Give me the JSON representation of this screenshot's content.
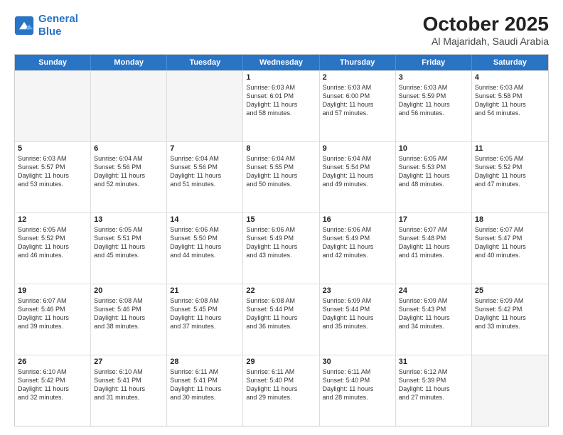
{
  "logo": {
    "line1": "General",
    "line2": "Blue"
  },
  "title": "October 2025",
  "subtitle": "Al Majaridah, Saudi Arabia",
  "days": [
    "Sunday",
    "Monday",
    "Tuesday",
    "Wednesday",
    "Thursday",
    "Friday",
    "Saturday"
  ],
  "weeks": [
    [
      {
        "day": "",
        "info": ""
      },
      {
        "day": "",
        "info": ""
      },
      {
        "day": "",
        "info": ""
      },
      {
        "day": "1",
        "info": "Sunrise: 6:03 AM\nSunset: 6:01 PM\nDaylight: 11 hours\nand 58 minutes."
      },
      {
        "day": "2",
        "info": "Sunrise: 6:03 AM\nSunset: 6:00 PM\nDaylight: 11 hours\nand 57 minutes."
      },
      {
        "day": "3",
        "info": "Sunrise: 6:03 AM\nSunset: 5:59 PM\nDaylight: 11 hours\nand 56 minutes."
      },
      {
        "day": "4",
        "info": "Sunrise: 6:03 AM\nSunset: 5:58 PM\nDaylight: 11 hours\nand 54 minutes."
      }
    ],
    [
      {
        "day": "5",
        "info": "Sunrise: 6:03 AM\nSunset: 5:57 PM\nDaylight: 11 hours\nand 53 minutes."
      },
      {
        "day": "6",
        "info": "Sunrise: 6:04 AM\nSunset: 5:56 PM\nDaylight: 11 hours\nand 52 minutes."
      },
      {
        "day": "7",
        "info": "Sunrise: 6:04 AM\nSunset: 5:56 PM\nDaylight: 11 hours\nand 51 minutes."
      },
      {
        "day": "8",
        "info": "Sunrise: 6:04 AM\nSunset: 5:55 PM\nDaylight: 11 hours\nand 50 minutes."
      },
      {
        "day": "9",
        "info": "Sunrise: 6:04 AM\nSunset: 5:54 PM\nDaylight: 11 hours\nand 49 minutes."
      },
      {
        "day": "10",
        "info": "Sunrise: 6:05 AM\nSunset: 5:53 PM\nDaylight: 11 hours\nand 48 minutes."
      },
      {
        "day": "11",
        "info": "Sunrise: 6:05 AM\nSunset: 5:52 PM\nDaylight: 11 hours\nand 47 minutes."
      }
    ],
    [
      {
        "day": "12",
        "info": "Sunrise: 6:05 AM\nSunset: 5:52 PM\nDaylight: 11 hours\nand 46 minutes."
      },
      {
        "day": "13",
        "info": "Sunrise: 6:05 AM\nSunset: 5:51 PM\nDaylight: 11 hours\nand 45 minutes."
      },
      {
        "day": "14",
        "info": "Sunrise: 6:06 AM\nSunset: 5:50 PM\nDaylight: 11 hours\nand 44 minutes."
      },
      {
        "day": "15",
        "info": "Sunrise: 6:06 AM\nSunset: 5:49 PM\nDaylight: 11 hours\nand 43 minutes."
      },
      {
        "day": "16",
        "info": "Sunrise: 6:06 AM\nSunset: 5:49 PM\nDaylight: 11 hours\nand 42 minutes."
      },
      {
        "day": "17",
        "info": "Sunrise: 6:07 AM\nSunset: 5:48 PM\nDaylight: 11 hours\nand 41 minutes."
      },
      {
        "day": "18",
        "info": "Sunrise: 6:07 AM\nSunset: 5:47 PM\nDaylight: 11 hours\nand 40 minutes."
      }
    ],
    [
      {
        "day": "19",
        "info": "Sunrise: 6:07 AM\nSunset: 5:46 PM\nDaylight: 11 hours\nand 39 minutes."
      },
      {
        "day": "20",
        "info": "Sunrise: 6:08 AM\nSunset: 5:46 PM\nDaylight: 11 hours\nand 38 minutes."
      },
      {
        "day": "21",
        "info": "Sunrise: 6:08 AM\nSunset: 5:45 PM\nDaylight: 11 hours\nand 37 minutes."
      },
      {
        "day": "22",
        "info": "Sunrise: 6:08 AM\nSunset: 5:44 PM\nDaylight: 11 hours\nand 36 minutes."
      },
      {
        "day": "23",
        "info": "Sunrise: 6:09 AM\nSunset: 5:44 PM\nDaylight: 11 hours\nand 35 minutes."
      },
      {
        "day": "24",
        "info": "Sunrise: 6:09 AM\nSunset: 5:43 PM\nDaylight: 11 hours\nand 34 minutes."
      },
      {
        "day": "25",
        "info": "Sunrise: 6:09 AM\nSunset: 5:42 PM\nDaylight: 11 hours\nand 33 minutes."
      }
    ],
    [
      {
        "day": "26",
        "info": "Sunrise: 6:10 AM\nSunset: 5:42 PM\nDaylight: 11 hours\nand 32 minutes."
      },
      {
        "day": "27",
        "info": "Sunrise: 6:10 AM\nSunset: 5:41 PM\nDaylight: 11 hours\nand 31 minutes."
      },
      {
        "day": "28",
        "info": "Sunrise: 6:11 AM\nSunset: 5:41 PM\nDaylight: 11 hours\nand 30 minutes."
      },
      {
        "day": "29",
        "info": "Sunrise: 6:11 AM\nSunset: 5:40 PM\nDaylight: 11 hours\nand 29 minutes."
      },
      {
        "day": "30",
        "info": "Sunrise: 6:11 AM\nSunset: 5:40 PM\nDaylight: 11 hours\nand 28 minutes."
      },
      {
        "day": "31",
        "info": "Sunrise: 6:12 AM\nSunset: 5:39 PM\nDaylight: 11 hours\nand 27 minutes."
      },
      {
        "day": "",
        "info": ""
      }
    ]
  ]
}
